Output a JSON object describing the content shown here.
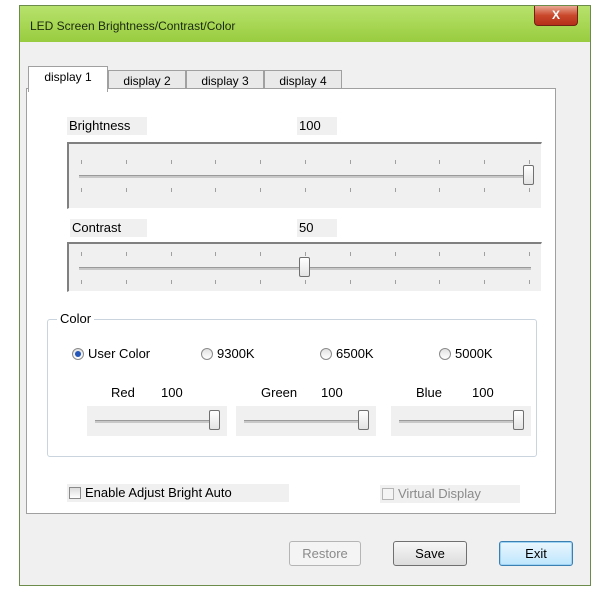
{
  "window": {
    "title": "LED Screen Brightness/Contrast/Color",
    "close_glyph": "X"
  },
  "tabs": [
    {
      "label": "display 1",
      "active": true
    },
    {
      "label": "display 2",
      "active": false
    },
    {
      "label": "display 3",
      "active": false
    },
    {
      "label": "display 4",
      "active": false
    }
  ],
  "brightness": {
    "label": "Brightness",
    "value": "100",
    "level": 100,
    "max": 100
  },
  "contrast": {
    "label": "Contrast",
    "value": "50",
    "level": 50,
    "max": 100
  },
  "color": {
    "group_label": "Color",
    "presets": [
      {
        "label": "User Color",
        "selected": true
      },
      {
        "label": "9300K",
        "selected": false
      },
      {
        "label": "6500K",
        "selected": false
      },
      {
        "label": "5000K",
        "selected": false
      }
    ],
    "channels": [
      {
        "label": "Red",
        "value": "100",
        "level": 100,
        "max": 100
      },
      {
        "label": "Green",
        "value": "100",
        "level": 100,
        "max": 100
      },
      {
        "label": "Blue",
        "value": "100",
        "level": 100,
        "max": 100
      }
    ]
  },
  "options": {
    "auto_bright_label": "Enable Adjust Bright Auto",
    "auto_bright_checked": false,
    "virtual_display_label": "Virtual Display",
    "virtual_display_checked": false,
    "virtual_display_enabled": false
  },
  "buttons": {
    "restore": "Restore",
    "save": "Save",
    "exit": "Exit"
  },
  "colors": {
    "titlebar": "#a4d34f",
    "close": "#c9472b",
    "accent": "#2356b8"
  }
}
